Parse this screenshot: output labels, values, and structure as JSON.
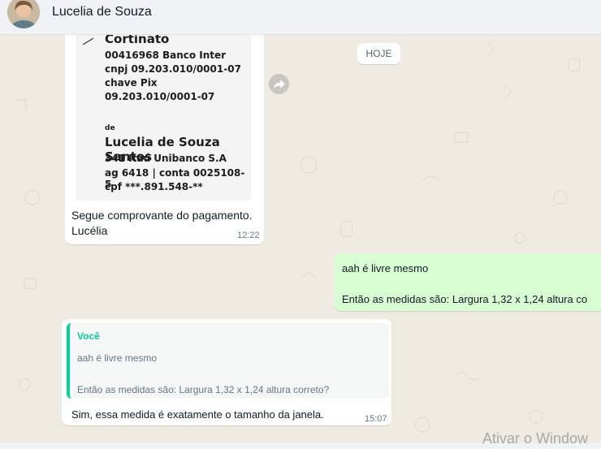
{
  "header": {
    "contact_name": "Lucelia de Souza"
  },
  "date_divider": "HOJE",
  "receipt": {
    "payee_name": "Cortinato",
    "payee_bank": "00416968 Banco Inter",
    "payee_cnpj": "cnpj 09.203.010/0001-07",
    "payee_pix_label": "chave Pix",
    "payee_pix": "09.203.010/0001-07",
    "from_label": "de",
    "payer_name": "Lucelia de Souza Santos",
    "payer_bank": "341 Itaú Unibanco S.A",
    "payer_account": "ag 6418 | conta 0025108-5",
    "payer_cpf": "cpf ***.891.548-**"
  },
  "messages": {
    "incoming_1": {
      "line1": "Segue comprovante do pagamento.",
      "line2": "Lucélia",
      "time": "12:22"
    },
    "outgoing_1": {
      "line1": "aah é livre mesmo",
      "line2": "Então as medidas são: Largura 1,32 x 1,24 altura co"
    },
    "incoming_2": {
      "quote_author": "Você",
      "quote_line1": "aah é livre mesmo",
      "quote_line2": "Então as medidas são: Largura 1,32 x 1,24 altura correto?",
      "text": "Sim, essa medida é exatamente o tamanho da janela.",
      "time": "15:07"
    }
  },
  "watermark": "Ativar o Window",
  "colors": {
    "chat_background": "#efeae2",
    "incoming_bubble": "#ffffff",
    "outgoing_bubble": "#d9fdd3",
    "quote_accent": "#06cf9c"
  }
}
